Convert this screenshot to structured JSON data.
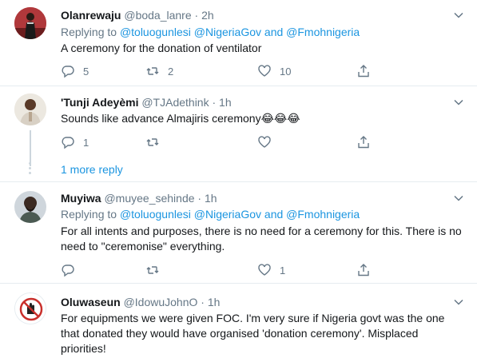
{
  "tweets": [
    {
      "name": "Olanrewaju",
      "handle": "@boda_lanre",
      "time": "2h",
      "replying_prefix": "Replying to",
      "mention1": "@toluogunlesi",
      "mention2": "@NigeriaGov",
      "and": "and",
      "mention3": "@Fmohnigeria",
      "text": "A ceremony for the donation of ventilator",
      "replies": "5",
      "retweets": "2",
      "likes": "10"
    },
    {
      "name": "'Tunji Adeyèmi",
      "handle": "@TJAdethink",
      "time": "1h",
      "text": "Sounds like advance Almajiris ceremony",
      "emoji": "😂😂😂",
      "replies": "1"
    },
    {
      "name": "Muyiwa",
      "handle": "@muyee_sehinde",
      "time": "1h",
      "replying_prefix": "Replying to",
      "mention1": "@toluogunlesi",
      "mention2": "@NigeriaGov",
      "and": "and",
      "mention3": "@Fmohnigeria",
      "text": "For all intents and purposes, there is no need for a ceremony for this. There is no need to \"ceremonise\" everything.",
      "likes": "1"
    },
    {
      "name": "Oluwaseun",
      "handle": "@IdowuJohnO",
      "time": "1h",
      "text": "For equipments we were given FOC. I'm very sure if Nigeria govt was the one that donated they would have organised 'donation ceremony'. Misplaced priorities!",
      "avatar_text": "DON'T LIKE THIS"
    }
  ],
  "more_replies": "1 more reply",
  "separator": "·",
  "colors": {
    "link": "#1b95e0",
    "meta": "#657786",
    "divider": "#e6ecf0"
  }
}
